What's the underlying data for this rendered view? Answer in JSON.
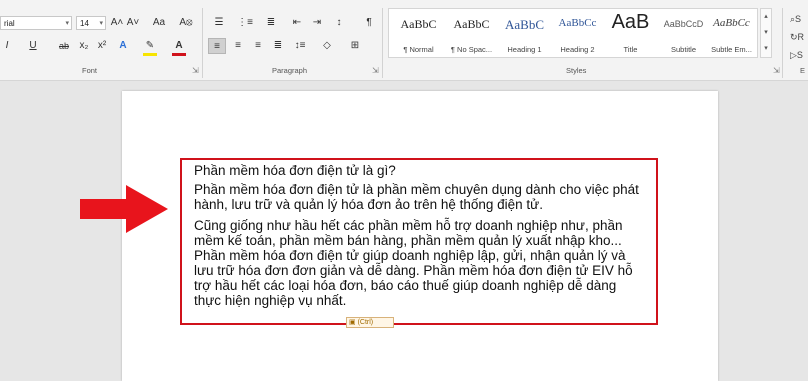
{
  "ribbon": {
    "font_group": {
      "label": "Font",
      "font_name": "rial",
      "font_size": "14",
      "grow_label": "A˄",
      "shrink_label": "A˅",
      "case_label": "Aa",
      "clear_label": "A⦻",
      "bold_partial": "I",
      "underline_label": "U",
      "strike_label": "ab",
      "sub_label": "x₂",
      "sup_label": "x²",
      "effects_label": "A",
      "highlight_color": "#f7e400",
      "font_color": "#d0121b",
      "font_color_label": "A"
    },
    "paragraph_group": {
      "label": "Paragraph"
    },
    "styles_group": {
      "label": "Styles",
      "items": [
        {
          "preview": "AaBbC",
          "name": "¶ Normal"
        },
        {
          "preview": "AaBbC",
          "name": "¶ No Spac..."
        },
        {
          "preview": "AaBbC",
          "name": "Heading 1"
        },
        {
          "preview": "AaBbCc",
          "name": "Heading 2"
        },
        {
          "preview": "AaB",
          "name": "Title"
        },
        {
          "preview": "AaBbCcD",
          "name": "Subtitle"
        },
        {
          "preview": "AaBbCc",
          "name": "Subtle Em..."
        }
      ]
    },
    "editing_group": {
      "label": "E",
      "items": [
        "S",
        "R",
        "S"
      ]
    }
  },
  "document": {
    "heading": "Phần mềm hóa đơn điện tử là gì?",
    "p1": [
      "Phần mềm hóa đơn điện tử là phần mềm chuyên dụng dành cho việc phát",
      "hành, lưu trữ và quản lý hóa đơn ảo trên hệ thống điện tử."
    ],
    "p2": [
      "Cũng giống như hầu hết các phần mềm hỗ trợ doanh nghiệp như, phần",
      "mềm kế toán, phần mềm bán hàng, phần mềm quản lý xuất nhập kho...",
      "Phần mềm hóa đơn điện tử giúp doanh nghiệp lập, gửi, nhận quản lý và",
      "lưu trữ hóa đơn đơn giản và dễ dàng. Phần mềm hóa đơn điện tử EIV hỗ",
      "trợ hầu hết các loại hóa đơn, báo cáo thuế giúp doanh nghiệp dễ dàng",
      "thực hiện nghiệp vụ nhất."
    ],
    "paste_label": "(Ctrl)"
  },
  "colors": {
    "highlight_box": "#d0121b",
    "arrow": "#e8141c"
  }
}
